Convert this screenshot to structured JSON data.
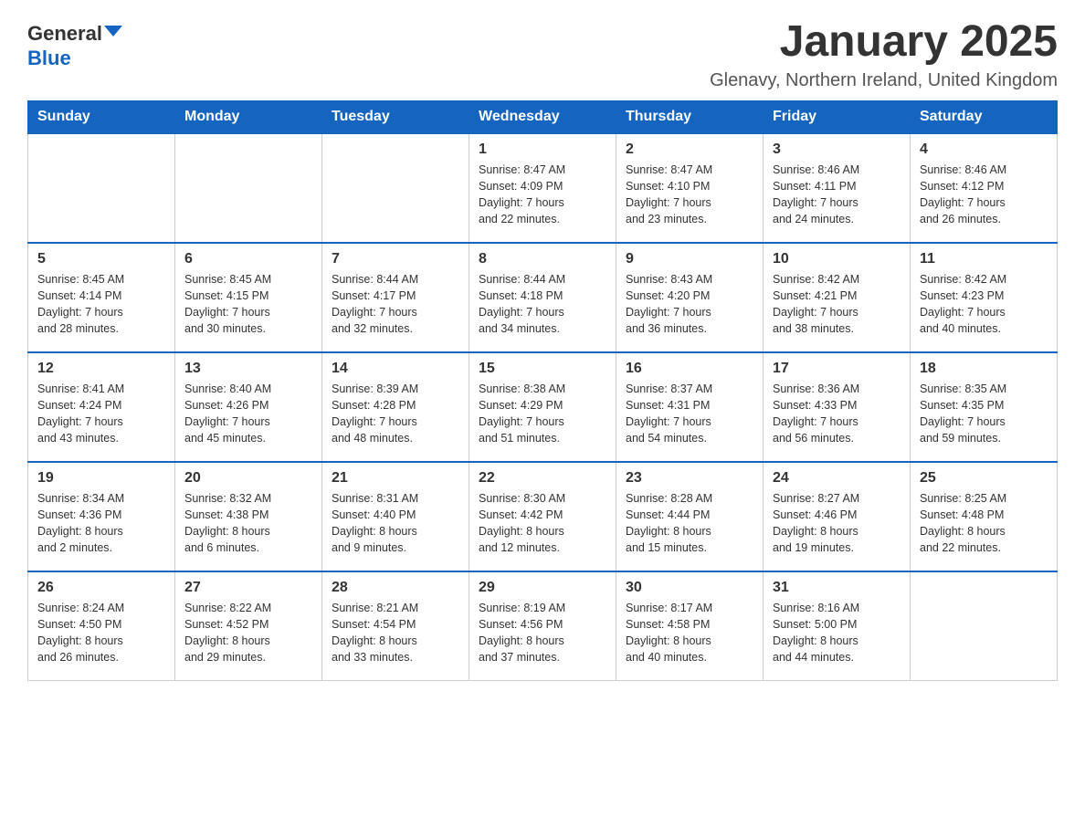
{
  "logo": {
    "text1": "General",
    "text2": "Blue"
  },
  "header": {
    "title": "January 2025",
    "subtitle": "Glenavy, Northern Ireland, United Kingdom"
  },
  "days_of_week": [
    "Sunday",
    "Monday",
    "Tuesday",
    "Wednesday",
    "Thursday",
    "Friday",
    "Saturday"
  ],
  "weeks": [
    [
      {
        "day": "",
        "info": ""
      },
      {
        "day": "",
        "info": ""
      },
      {
        "day": "",
        "info": ""
      },
      {
        "day": "1",
        "info": "Sunrise: 8:47 AM\nSunset: 4:09 PM\nDaylight: 7 hours\nand 22 minutes."
      },
      {
        "day": "2",
        "info": "Sunrise: 8:47 AM\nSunset: 4:10 PM\nDaylight: 7 hours\nand 23 minutes."
      },
      {
        "day": "3",
        "info": "Sunrise: 8:46 AM\nSunset: 4:11 PM\nDaylight: 7 hours\nand 24 minutes."
      },
      {
        "day": "4",
        "info": "Sunrise: 8:46 AM\nSunset: 4:12 PM\nDaylight: 7 hours\nand 26 minutes."
      }
    ],
    [
      {
        "day": "5",
        "info": "Sunrise: 8:45 AM\nSunset: 4:14 PM\nDaylight: 7 hours\nand 28 minutes."
      },
      {
        "day": "6",
        "info": "Sunrise: 8:45 AM\nSunset: 4:15 PM\nDaylight: 7 hours\nand 30 minutes."
      },
      {
        "day": "7",
        "info": "Sunrise: 8:44 AM\nSunset: 4:17 PM\nDaylight: 7 hours\nand 32 minutes."
      },
      {
        "day": "8",
        "info": "Sunrise: 8:44 AM\nSunset: 4:18 PM\nDaylight: 7 hours\nand 34 minutes."
      },
      {
        "day": "9",
        "info": "Sunrise: 8:43 AM\nSunset: 4:20 PM\nDaylight: 7 hours\nand 36 minutes."
      },
      {
        "day": "10",
        "info": "Sunrise: 8:42 AM\nSunset: 4:21 PM\nDaylight: 7 hours\nand 38 minutes."
      },
      {
        "day": "11",
        "info": "Sunrise: 8:42 AM\nSunset: 4:23 PM\nDaylight: 7 hours\nand 40 minutes."
      }
    ],
    [
      {
        "day": "12",
        "info": "Sunrise: 8:41 AM\nSunset: 4:24 PM\nDaylight: 7 hours\nand 43 minutes."
      },
      {
        "day": "13",
        "info": "Sunrise: 8:40 AM\nSunset: 4:26 PM\nDaylight: 7 hours\nand 45 minutes."
      },
      {
        "day": "14",
        "info": "Sunrise: 8:39 AM\nSunset: 4:28 PM\nDaylight: 7 hours\nand 48 minutes."
      },
      {
        "day": "15",
        "info": "Sunrise: 8:38 AM\nSunset: 4:29 PM\nDaylight: 7 hours\nand 51 minutes."
      },
      {
        "day": "16",
        "info": "Sunrise: 8:37 AM\nSunset: 4:31 PM\nDaylight: 7 hours\nand 54 minutes."
      },
      {
        "day": "17",
        "info": "Sunrise: 8:36 AM\nSunset: 4:33 PM\nDaylight: 7 hours\nand 56 minutes."
      },
      {
        "day": "18",
        "info": "Sunrise: 8:35 AM\nSunset: 4:35 PM\nDaylight: 7 hours\nand 59 minutes."
      }
    ],
    [
      {
        "day": "19",
        "info": "Sunrise: 8:34 AM\nSunset: 4:36 PM\nDaylight: 8 hours\nand 2 minutes."
      },
      {
        "day": "20",
        "info": "Sunrise: 8:32 AM\nSunset: 4:38 PM\nDaylight: 8 hours\nand 6 minutes."
      },
      {
        "day": "21",
        "info": "Sunrise: 8:31 AM\nSunset: 4:40 PM\nDaylight: 8 hours\nand 9 minutes."
      },
      {
        "day": "22",
        "info": "Sunrise: 8:30 AM\nSunset: 4:42 PM\nDaylight: 8 hours\nand 12 minutes."
      },
      {
        "day": "23",
        "info": "Sunrise: 8:28 AM\nSunset: 4:44 PM\nDaylight: 8 hours\nand 15 minutes."
      },
      {
        "day": "24",
        "info": "Sunrise: 8:27 AM\nSunset: 4:46 PM\nDaylight: 8 hours\nand 19 minutes."
      },
      {
        "day": "25",
        "info": "Sunrise: 8:25 AM\nSunset: 4:48 PM\nDaylight: 8 hours\nand 22 minutes."
      }
    ],
    [
      {
        "day": "26",
        "info": "Sunrise: 8:24 AM\nSunset: 4:50 PM\nDaylight: 8 hours\nand 26 minutes."
      },
      {
        "day": "27",
        "info": "Sunrise: 8:22 AM\nSunset: 4:52 PM\nDaylight: 8 hours\nand 29 minutes."
      },
      {
        "day": "28",
        "info": "Sunrise: 8:21 AM\nSunset: 4:54 PM\nDaylight: 8 hours\nand 33 minutes."
      },
      {
        "day": "29",
        "info": "Sunrise: 8:19 AM\nSunset: 4:56 PM\nDaylight: 8 hours\nand 37 minutes."
      },
      {
        "day": "30",
        "info": "Sunrise: 8:17 AM\nSunset: 4:58 PM\nDaylight: 8 hours\nand 40 minutes."
      },
      {
        "day": "31",
        "info": "Sunrise: 8:16 AM\nSunset: 5:00 PM\nDaylight: 8 hours\nand 44 minutes."
      },
      {
        "day": "",
        "info": ""
      }
    ]
  ]
}
